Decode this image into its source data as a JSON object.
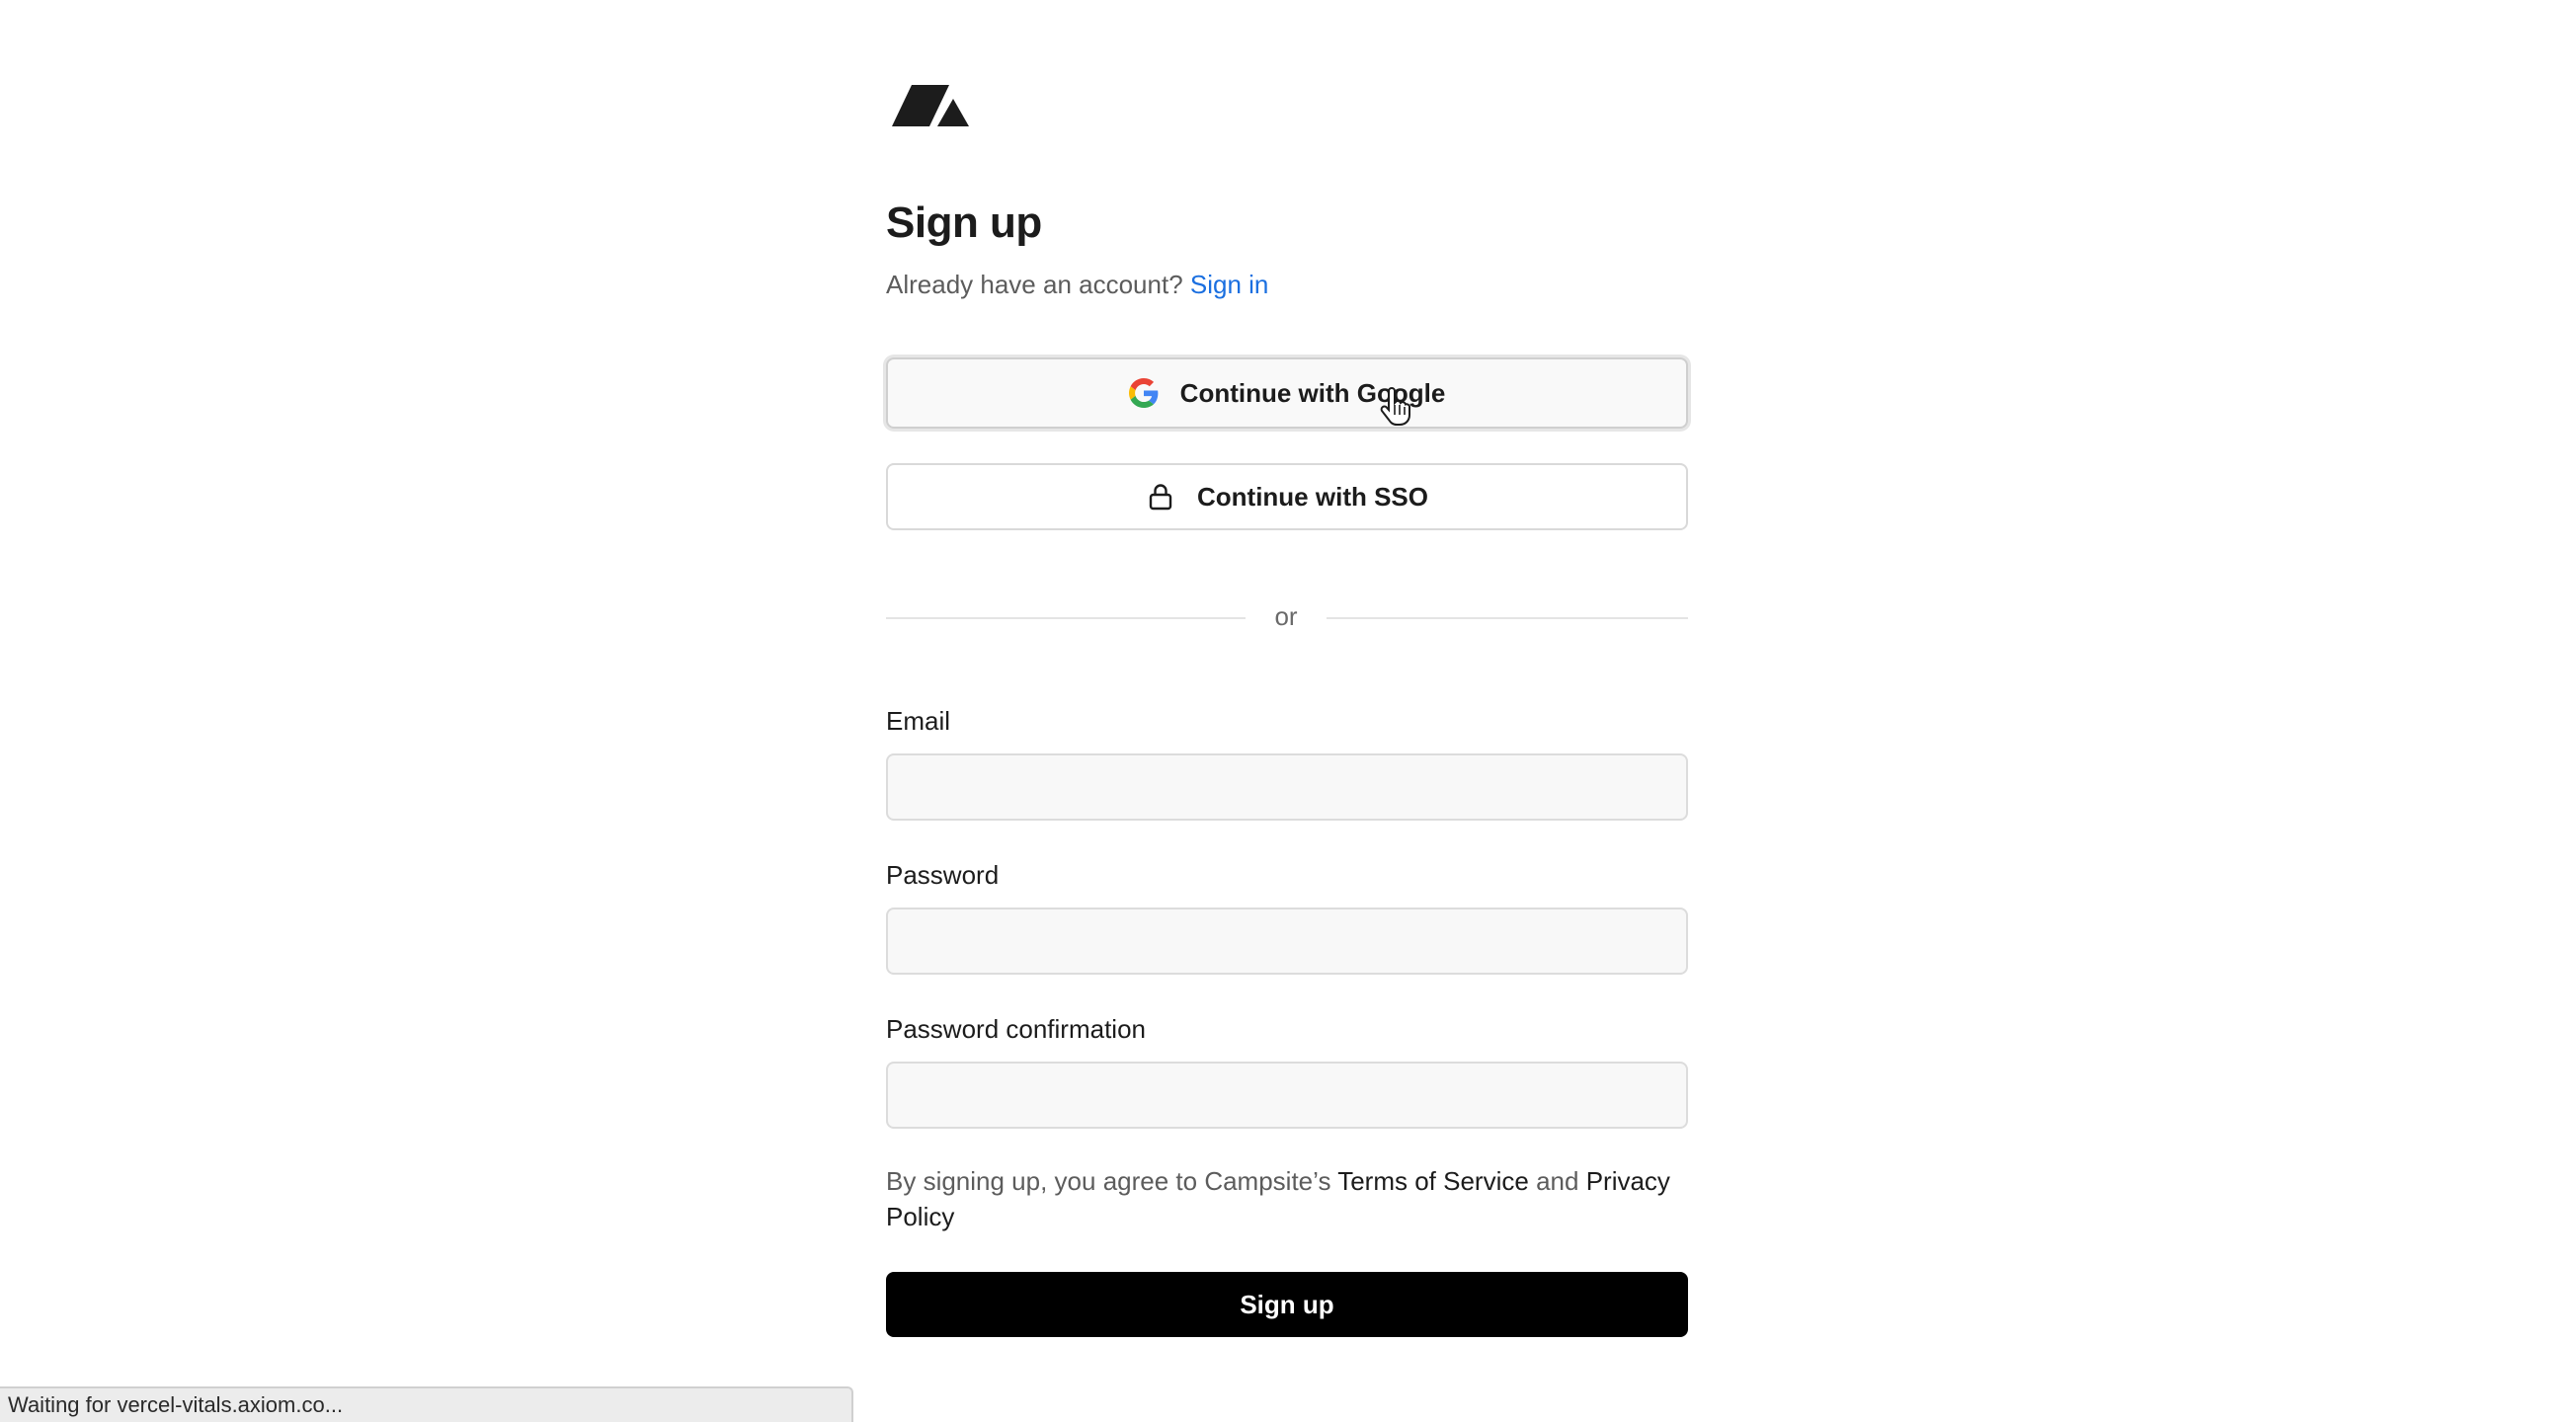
{
  "header": {
    "logo_icon": "campsite-logo-icon"
  },
  "signup": {
    "title": "Sign up",
    "have_account_text": "Already have an account?",
    "sign_in_link": "Sign in"
  },
  "oauth": {
    "google_label": "Continue with Google",
    "google_icon": "google-icon",
    "sso_label": "Continue with SSO",
    "sso_icon": "lock-icon"
  },
  "divider": {
    "text": "or"
  },
  "form": {
    "email_label": "Email",
    "email_value": "",
    "password_label": "Password",
    "password_value": "",
    "password_confirmation_label": "Password confirmation",
    "password_confirmation_value": ""
  },
  "terms": {
    "prefix": "By signing up, you agree to Campsite’s",
    "terms_link": "Terms of Service",
    "and": "and",
    "privacy_link": "Privacy Policy"
  },
  "submit": {
    "label": "Sign up"
  },
  "status_bar": {
    "text": "Waiting for vercel-vitals.axiom.co..."
  },
  "colors": {
    "accent_link": "#1a6fe0",
    "primary_button": "#000000",
    "input_background": "#f8f8f8"
  }
}
